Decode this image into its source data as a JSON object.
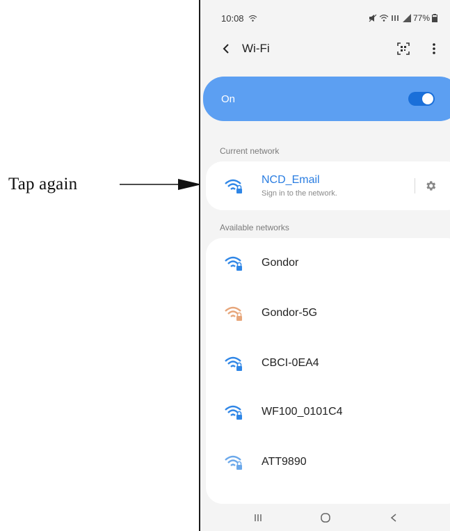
{
  "annotation": {
    "text": "Tap again"
  },
  "status_bar": {
    "time": "10:08",
    "battery": "77%",
    "battery_level": 0.77
  },
  "app_bar": {
    "title": "Wi-Fi",
    "icons": [
      "back-icon",
      "qr-scan-icon",
      "more-options-icon"
    ]
  },
  "wifi_toggle": {
    "label": "On",
    "state": true
  },
  "current_network": {
    "section_label": "Current network",
    "name": "NCD_Email",
    "status": "Sign in to the network.",
    "icon": "wifi-lock-icon"
  },
  "available_networks": {
    "section_label": "Available networks",
    "items": [
      {
        "name": "Gondor",
        "signal": "strong"
      },
      {
        "name": "Gondor-5G",
        "signal": "weak"
      },
      {
        "name": "CBCI-0EA4",
        "signal": "strong"
      },
      {
        "name": "WF100_0101C4",
        "signal": "strong"
      },
      {
        "name": "ATT9890",
        "signal": "medium"
      }
    ]
  },
  "colors": {
    "accent": "#2a7de1",
    "toggle_card": "#5c9ff2",
    "wifi_strong": "#2f86e6",
    "wifi_medium": "#6ba8ea",
    "wifi_weak": "#e7a67a"
  },
  "nav_bar": {
    "icons": [
      "recent-apps-icon",
      "home-icon",
      "back-nav-icon"
    ]
  }
}
